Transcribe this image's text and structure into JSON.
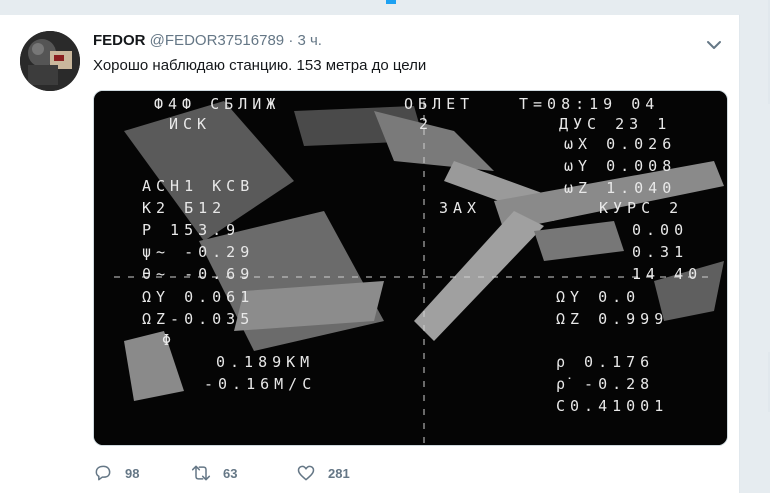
{
  "tweet": {
    "author_name": "FEDOR",
    "author_handle": "@FEDOR37516789",
    "separator": "·",
    "time_ago": "3 ч.",
    "text": "Хорошо наблюдаю станцию. 153 метра до цели",
    "media": {
      "hud_lines": {
        "top_left": "Ф4Ф СБЛИЖ",
        "top_mid": "ОБЛЕТ",
        "top_right": "Т=08:19 04",
        "row2_left": "ИСК",
        "row2_mid": "2",
        "row2_right": "ДУС 23 1",
        "r3": "ωX 0.026",
        "r4": "ωY 0.008",
        "r5": "ωZ 1.040",
        "l_ash": "АСН1 КСВ",
        "l_k2": "К2 Б12",
        "mid_zah": "ЗАХ",
        "r_kurs": "КУРС 2",
        "l_p": "Р 153.9",
        "r_000": "0.00",
        "l_psi": "ψ~ -0.29",
        "r_031": "0.31",
        "l_theta": "θ~ -0.69",
        "r_040": "14 40",
        "l_wy": "ΩY 0.061",
        "r_wy": "ΩY 0.0",
        "l_wz": "ΩZ-0.035",
        "r_wz": "ΩZ 0.999",
        "l_phi": "Φ",
        "l_km": "0.189КМ",
        "l_ms": "-0.16М/С",
        "r_rho": "ρ 0.176",
        "r_rhodot": "ρ̇ -0.28",
        "r_co": "С0.41001"
      }
    },
    "replies": "98",
    "retweets": "63",
    "likes": "281"
  },
  "colors": {
    "accent": "#1da1f2",
    "text_primary": "#14171a",
    "text_secondary": "#657786"
  },
  "icons": [
    "avatar-image",
    "chevron-down-icon",
    "reply-icon",
    "retweet-icon",
    "like-icon"
  ]
}
